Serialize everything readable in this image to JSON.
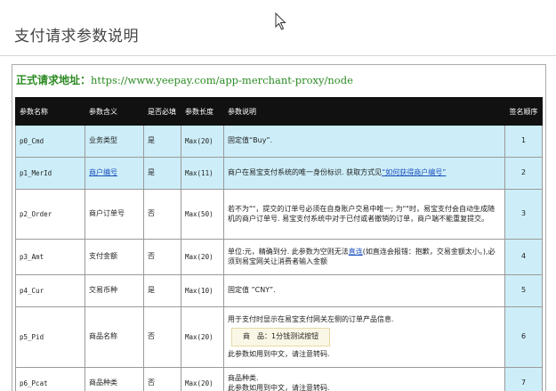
{
  "page": {
    "title": "支付请求参数说明"
  },
  "request_url": {
    "label": "正式请求地址：",
    "value": "https://www.yeepay.com/app-merchant-proxy/node"
  },
  "table": {
    "headers": [
      "参数名称",
      "参数含义",
      "是否必填",
      "参数长度",
      "参数说明",
      "签名顺序"
    ],
    "rows": [
      {
        "name": "p0_Cmd",
        "meaning": "业务类型",
        "required": "是",
        "length": "Max(20)",
        "desc": "固定值“Buy”.",
        "order": "1"
      },
      {
        "name": "p1_MerId",
        "meaning": "商户编号",
        "required": "是",
        "length": "Max(11)",
        "desc_prefix": "商户在易宝支付系统的唯一身份标识. 获取方式见",
        "desc_link": "“如何获得商户编号”",
        "order": "2"
      },
      {
        "name": "p2_Order",
        "meaning": "商户订单号",
        "required": "否",
        "length": "Max(50)",
        "desc": "若不为\"\"，提交的订单号必须在自身账户交易中唯一; 为\"\"时，易宝支付会自动生成随机的商户订单号. 易宝支付系统中对于已付或者撤销的订单，商户端不能重复提交。",
        "order": "3"
      },
      {
        "name": "p3_Amt",
        "meaning": "支付金额",
        "required": "否",
        "length": "Max(20)",
        "desc_prefix": "单位:元，精确到分. 此参数为空则无法",
        "desc_link": "直连",
        "desc_suffix": "(如直连会报错：抱歉，交易金额太小。),必须到易宝网关让消费者输入金额",
        "order": "4"
      },
      {
        "name": "p4_Cur",
        "meaning": "交易币种",
        "required": "是",
        "length": "Max(10)",
        "desc": "固定值 ”CNY”.",
        "order": "5"
      },
      {
        "name": "p5_Pid",
        "meaning": "商品名称",
        "required": "否",
        "length": "Max(20)",
        "desc_line1": "用于支付时显示在易宝支付网关左侧的订单产品信息.",
        "product_label": "商　品：",
        "product_value": "1分钱测试按钮",
        "desc_line2": "此参数如用到中文，请注意转码.",
        "order": "6"
      },
      {
        "name": "p6_Pcat",
        "meaning": "商品种类",
        "required": "否",
        "length": "Max(20)",
        "desc_line1": "商品种类.",
        "desc_line2": "此参数如用到中文，请注意转码.",
        "order": "7"
      }
    ]
  }
}
